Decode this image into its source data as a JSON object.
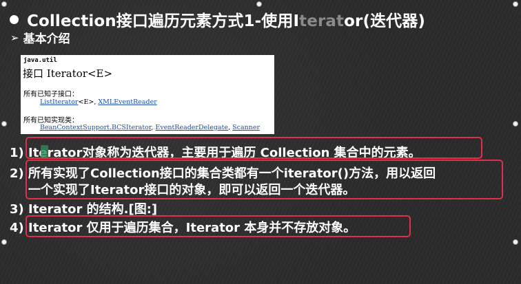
{
  "slide": {
    "title_pre": "Collection接口遍历元素方式1-使用I",
    "title_highlight": "terat",
    "title_post": "or(迭代器)",
    "subtitle_marker": "➢",
    "subtitle": "基本介绍"
  },
  "doc": {
    "package": "java.util",
    "interface_title": "接口 Iterator<E>",
    "known_subinterfaces_label": "所有已知子接口：",
    "subinterface_1": "ListIterator",
    "subinterface_1_suffix": "<E>, ",
    "subinterface_2": "XMLEventReader",
    "known_impl_label": "所有已知实现类：",
    "impl_1": "BeanContextSupport.BCSIterator",
    "sep_1": ", ",
    "impl_2": "EventReaderDelegate",
    "sep_2": ", ",
    "impl_3": "Scanner"
  },
  "items": [
    {
      "text": "1) Iterator对象称为迭代器，主要用于遍历 Collection 集合中的元素。"
    },
    {
      "text": "2) 所有实现了Collection接口的集合类都有一个iterator()方法，用以返回"
    },
    {
      "text": "一个实现了Iterator接口的对象，即可以返回一个迭代器。"
    },
    {
      "text": "3) Iterator 的结构.[图:]"
    },
    {
      "text": "4) Iterator 仅用于遍历集合，Iterator 本身并不存放对象。"
    }
  ],
  "colors": {
    "background": "#2b2b2b",
    "highlight_box": "#e0304a",
    "link": "#1a4ea8",
    "title_highlight": "#8a8a8a"
  }
}
